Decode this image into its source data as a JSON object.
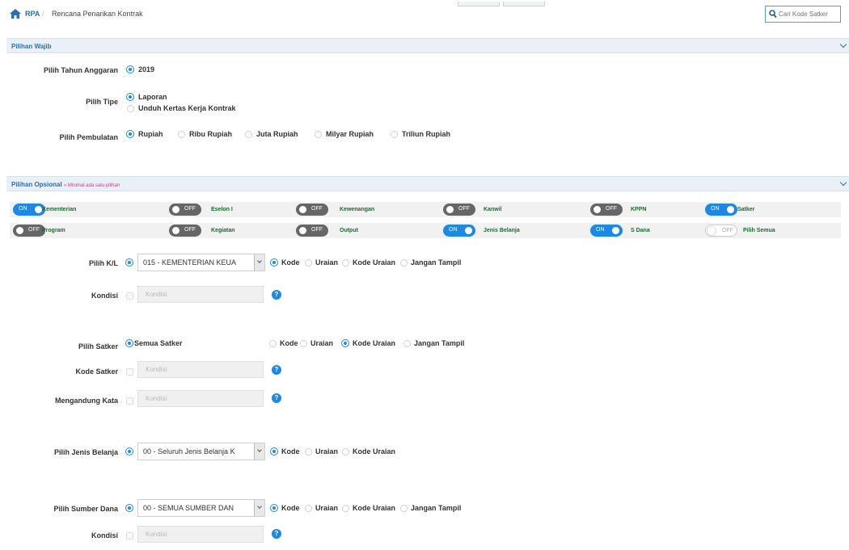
{
  "breadcrumb": {
    "root": "RPA",
    "separator": "/",
    "current": "Rencana Penarikan Kontrak"
  },
  "search": {
    "placeholder": "Cari Kode Satker"
  },
  "wajib": {
    "header": "Pilihan Wajib",
    "tahun": {
      "label": "Pilih Tahun Anggaran",
      "value": "2019"
    },
    "tipe": {
      "label": "Pilih Tipe",
      "options": [
        "Laporan",
        "Unduh Kertas Kerja Kontrak"
      ],
      "selected": "Laporan"
    },
    "pembulatan": {
      "label": "Pilih Pembulatan",
      "options": [
        "Rupiah",
        "Ribu Rupiah",
        "Juta Rupiah",
        "Milyar Rupiah",
        "Triliun Rupiah"
      ],
      "selected": "Rupiah"
    }
  },
  "opsional": {
    "header": "Pilihan Opsional",
    "header_note": "» Minimal ada satu pilihan",
    "toggles_row1": [
      {
        "label": "Kementerian",
        "state": "ON"
      },
      {
        "label": "Eselon I",
        "state": "OFF"
      },
      {
        "label": "Kewenangan",
        "state": "OFF"
      },
      {
        "label": "Kanwil",
        "state": "OFF"
      },
      {
        "label": "KPPN",
        "state": "OFF"
      },
      {
        "label": "Satker",
        "state": "ON"
      }
    ],
    "toggles_row2": [
      {
        "label": "Program",
        "state": "OFF"
      },
      {
        "label": "Kegiatan",
        "state": "OFF"
      },
      {
        "label": "Output",
        "state": "OFF"
      },
      {
        "label": "Jenis Belanja",
        "state": "ON"
      },
      {
        "label": "S Dana",
        "state": "ON"
      },
      {
        "label": "Pilih Semua",
        "state": "OFF"
      }
    ]
  },
  "kl": {
    "label": "Pilih K/L",
    "select_value": "015 - KEMENTERIAN KEUA",
    "display_options": [
      "Kode",
      "Uraian",
      "Kode Uraian",
      "Jangan Tampil"
    ],
    "display_selected": "Kode",
    "kondisi_label": "Kondisi",
    "kondisi_placeholder": "Kondisi"
  },
  "satker": {
    "label": "Pilih Satker",
    "all_option": "Semua Satker",
    "display_options": [
      "Kode",
      "Uraian",
      "Kode Uraian",
      "Jangan Tampil"
    ],
    "display_selected": "Kode Uraian",
    "kode_label": "Kode Satker",
    "kode_placeholder": "Kondisi",
    "kata_label": "Mengandung Kata",
    "kata_placeholder": "Kondisi"
  },
  "jenis_belanja": {
    "label": "Pilih Jenis Belanja",
    "select_value": "00 - Seluruh Jenis Belanja K",
    "display_options": [
      "Kode",
      "Uraian",
      "Kode Uraian"
    ],
    "display_selected": "Kode"
  },
  "sumber_dana": {
    "label": "Pilih Sumber Dana",
    "select_value": "00 - SEMUA SUMBER DAN",
    "display_options": [
      "Kode",
      "Uraian",
      "Kode Uraian",
      "Jangan Tampil"
    ],
    "display_selected": "Kode",
    "kondisi_label": "Kondisi",
    "kondisi_placeholder": "Kondisi"
  },
  "help_glyph": "?",
  "colors": {
    "accent": "#1e88e5",
    "header_bg": "#e9f0f8",
    "toggle_off": "#666666",
    "toggle_label": "#1d6b2f",
    "note": "#d43a8c"
  }
}
